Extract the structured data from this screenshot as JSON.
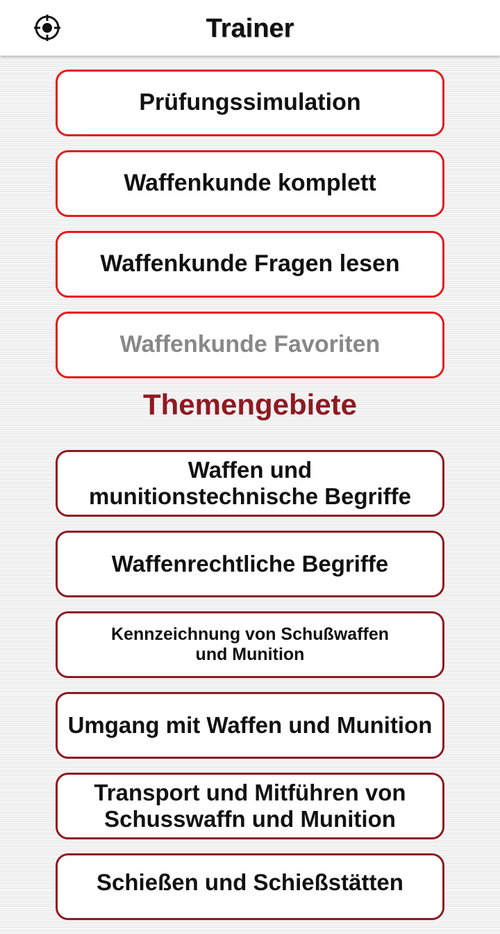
{
  "header": {
    "title": "Trainer",
    "icon": "crosshair-icon"
  },
  "menu": {
    "items": [
      {
        "label": "Prüfungssimulation",
        "enabled": true
      },
      {
        "label": "Waffenkunde komplett",
        "enabled": true
      },
      {
        "label": "Waffenkunde Fragen lesen",
        "enabled": true
      },
      {
        "label": "Waffenkunde Favoriten",
        "enabled": false
      }
    ]
  },
  "topics": {
    "title": "Themengebiete",
    "items": [
      {
        "label": "Waffen und\nmunitionstechnische Begriffe"
      },
      {
        "label": "Waffenrechtliche Begriffe"
      },
      {
        "label": "Kennzeichnung von Schußwaffen\nund Munition"
      },
      {
        "label": "Umgang mit Waffen und Munition"
      },
      {
        "label": "Transport und Mitführen von\nSchusswaffn und Munition"
      },
      {
        "label": "Schießen und Schießstätten"
      }
    ]
  },
  "colors": {
    "primary_border": "#e31b1b",
    "topic_border": "#8e1a22",
    "section_title": "#8e1a22",
    "disabled_text": "#888888"
  }
}
